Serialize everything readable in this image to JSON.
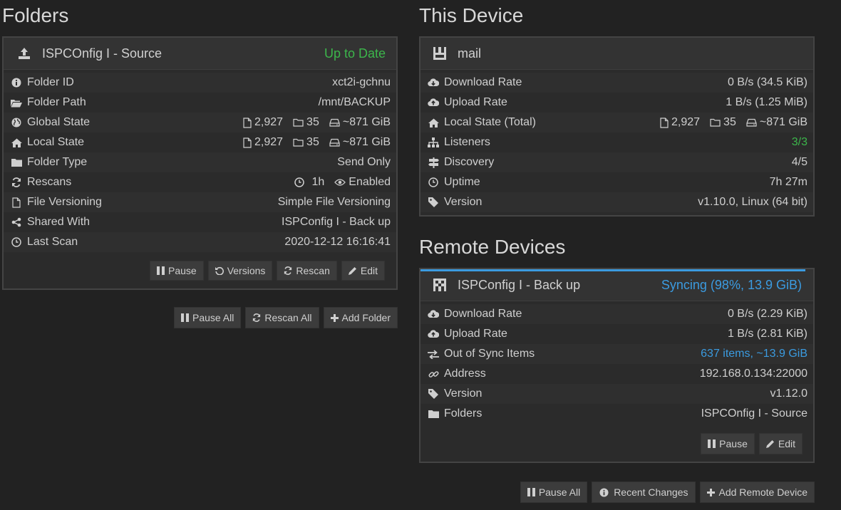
{
  "folders": {
    "heading": "Folders",
    "folder": {
      "name": "ISPCOnfig I - Source",
      "status": "Up to Date",
      "rows": {
        "folder_id": {
          "label": "Folder ID",
          "value": "xct2i-gchnu"
        },
        "folder_path": {
          "label": "Folder Path",
          "value": "/mnt/BACKUP"
        },
        "global_state": {
          "label": "Global State",
          "files": "2,927",
          "dirs": "35",
          "size": "~871 GiB"
        },
        "local_state": {
          "label": "Local State",
          "files": "2,927",
          "dirs": "35",
          "size": "~871 GiB"
        },
        "folder_type": {
          "label": "Folder Type",
          "value": "Send Only"
        },
        "rescans": {
          "label": "Rescans",
          "interval": "1h",
          "watcher": "Enabled"
        },
        "file_versioning": {
          "label": "File Versioning",
          "value": "Simple File Versioning"
        },
        "shared_with": {
          "label": "Shared With",
          "value": "ISPConfig I - Back up"
        },
        "last_scan": {
          "label": "Last Scan",
          "value": "2020-12-12 16:16:41"
        }
      },
      "buttons": {
        "pause": "Pause",
        "versions": "Versions",
        "rescan": "Rescan",
        "edit": "Edit"
      }
    },
    "buttons": {
      "pause_all": "Pause All",
      "rescan_all": "Rescan All",
      "add_folder": "Add Folder"
    }
  },
  "this_device": {
    "heading": "This Device",
    "name": "mail",
    "rows": {
      "download_rate": {
        "label": "Download Rate",
        "value": "0 B/s (34.5 KiB)"
      },
      "upload_rate": {
        "label": "Upload Rate",
        "value": "1 B/s (1.25 MiB)"
      },
      "local_state": {
        "label": "Local State (Total)",
        "files": "2,927",
        "dirs": "35",
        "size": "~871 GiB"
      },
      "listeners": {
        "label": "Listeners",
        "value": "3/3"
      },
      "discovery": {
        "label": "Discovery",
        "value": "4/5"
      },
      "uptime": {
        "label": "Uptime",
        "value": "7h 27m"
      },
      "version": {
        "label": "Version",
        "value": "v1.10.0, Linux (64 bit)"
      }
    }
  },
  "remote_devices": {
    "heading": "Remote Devices",
    "device": {
      "name": "ISPConfig I - Back up",
      "status": "Syncing (98%, 13.9 GiB)",
      "sync_progress": 0.98,
      "rows": {
        "download_rate": {
          "label": "Download Rate",
          "value": "0 B/s (2.29 KiB)"
        },
        "upload_rate": {
          "label": "Upload Rate",
          "value": "1 B/s (2.81 KiB)"
        },
        "out_of_sync": {
          "label": "Out of Sync Items",
          "value": "637 items, ~13.9 GiB"
        },
        "address": {
          "label": "Address",
          "value": "192.168.0.134:22000"
        },
        "version": {
          "label": "Version",
          "value": "v1.12.0"
        },
        "folders": {
          "label": "Folders",
          "value": "ISPCOnfig I - Source"
        }
      },
      "buttons": {
        "pause": "Pause",
        "edit": "Edit"
      }
    },
    "buttons": {
      "pause_all": "Pause All",
      "recent_changes": "Recent Changes",
      "add_remote": "Add Remote Device"
    }
  },
  "colors": {
    "background": "#222222",
    "up_to_date": "#3cb64b",
    "syncing": "#3b9be0",
    "panel_border": "#444444"
  }
}
